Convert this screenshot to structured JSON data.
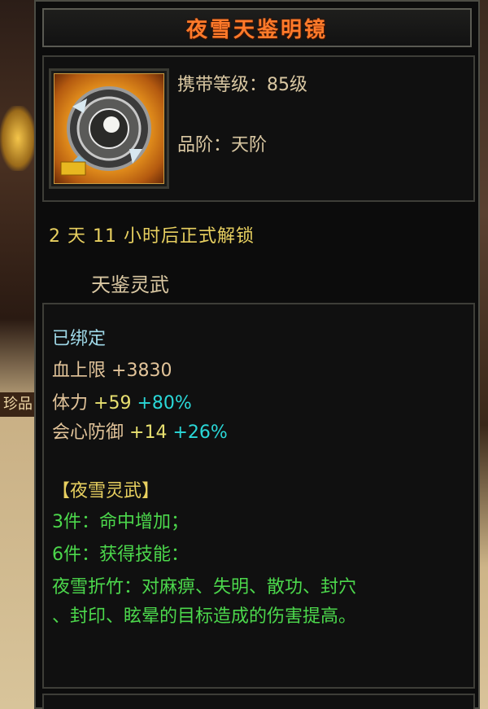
{
  "background": {
    "side_label": "珍品"
  },
  "tooltip": {
    "title": "夜雪天鉴明镜",
    "carry_level": "携带等级：85级",
    "grade": "品阶：天阶",
    "unlock_text": "2 天 11 小时后正式解锁",
    "category": "天鉴灵武",
    "bound": "已绑定",
    "stats": {
      "hp_label": "血上限",
      "hp_value": "+3830",
      "stamina_label": "体力",
      "stamina_value": "+59",
      "stamina_pct": "+80%",
      "crit_def_label": "会心防御",
      "crit_def_value": "+14",
      "crit_def_pct": "+26%"
    },
    "set": {
      "name": "【夜雪灵武】",
      "piece3": "3件：命中增加；",
      "piece6": "6件：获得技能：",
      "skill_line1": "夜雪折竹：对麻痹、失明、散功、封穴",
      "skill_line2": "、封印、眩晕的目标造成的伤害提高。"
    }
  }
}
